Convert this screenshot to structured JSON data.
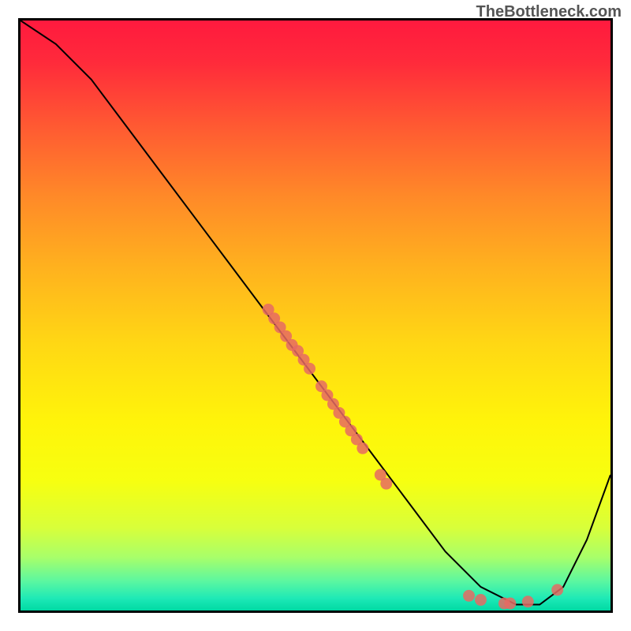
{
  "watermark": "TheBottleneck.com",
  "chart_data": {
    "type": "line",
    "title": "",
    "xlabel": "",
    "ylabel": "",
    "xlim": [
      0,
      100
    ],
    "ylim": [
      0,
      100
    ],
    "curve": {
      "x": [
        0,
        6,
        12,
        18,
        24,
        30,
        36,
        42,
        48,
        54,
        60,
        66,
        72,
        78,
        84,
        88,
        92,
        96,
        100
      ],
      "y": [
        100,
        96,
        90,
        82,
        74,
        66,
        58,
        50,
        42,
        34,
        26,
        18,
        10,
        4,
        1,
        1,
        4,
        12,
        23
      ]
    },
    "data_points": [
      {
        "x": 42,
        "y": 51
      },
      {
        "x": 43,
        "y": 49.5
      },
      {
        "x": 44,
        "y": 48
      },
      {
        "x": 45,
        "y": 46.5
      },
      {
        "x": 46,
        "y": 45
      },
      {
        "x": 47,
        "y": 44
      },
      {
        "x": 48,
        "y": 42.5
      },
      {
        "x": 49,
        "y": 41
      },
      {
        "x": 51,
        "y": 38
      },
      {
        "x": 52,
        "y": 36.5
      },
      {
        "x": 53,
        "y": 35
      },
      {
        "x": 54,
        "y": 33.5
      },
      {
        "x": 55,
        "y": 32
      },
      {
        "x": 56,
        "y": 30.5
      },
      {
        "x": 57,
        "y": 29
      },
      {
        "x": 58,
        "y": 27.5
      },
      {
        "x": 61,
        "y": 23
      },
      {
        "x": 62,
        "y": 21.5
      },
      {
        "x": 76,
        "y": 2.5
      },
      {
        "x": 78,
        "y": 1.8
      },
      {
        "x": 82,
        "y": 1.2
      },
      {
        "x": 83,
        "y": 1.2
      },
      {
        "x": 86,
        "y": 1.5
      },
      {
        "x": 91,
        "y": 3.5
      }
    ],
    "point_color": "#e66a63",
    "curve_color": "#000000",
    "gradient_stops": [
      {
        "pos": 0.0,
        "color": "#ff1a3e"
      },
      {
        "pos": 0.07,
        "color": "#ff2a3b"
      },
      {
        "pos": 0.18,
        "color": "#ff5a32"
      },
      {
        "pos": 0.3,
        "color": "#ff8a28"
      },
      {
        "pos": 0.42,
        "color": "#ffb21e"
      },
      {
        "pos": 0.55,
        "color": "#ffd814"
      },
      {
        "pos": 0.68,
        "color": "#fff40a"
      },
      {
        "pos": 0.78,
        "color": "#f7ff10"
      },
      {
        "pos": 0.86,
        "color": "#d8ff3a"
      },
      {
        "pos": 0.91,
        "color": "#a8ff6a"
      },
      {
        "pos": 0.95,
        "color": "#5cf7a0"
      },
      {
        "pos": 0.98,
        "color": "#1de9b6"
      },
      {
        "pos": 1.0,
        "color": "#00d9a3"
      }
    ]
  }
}
